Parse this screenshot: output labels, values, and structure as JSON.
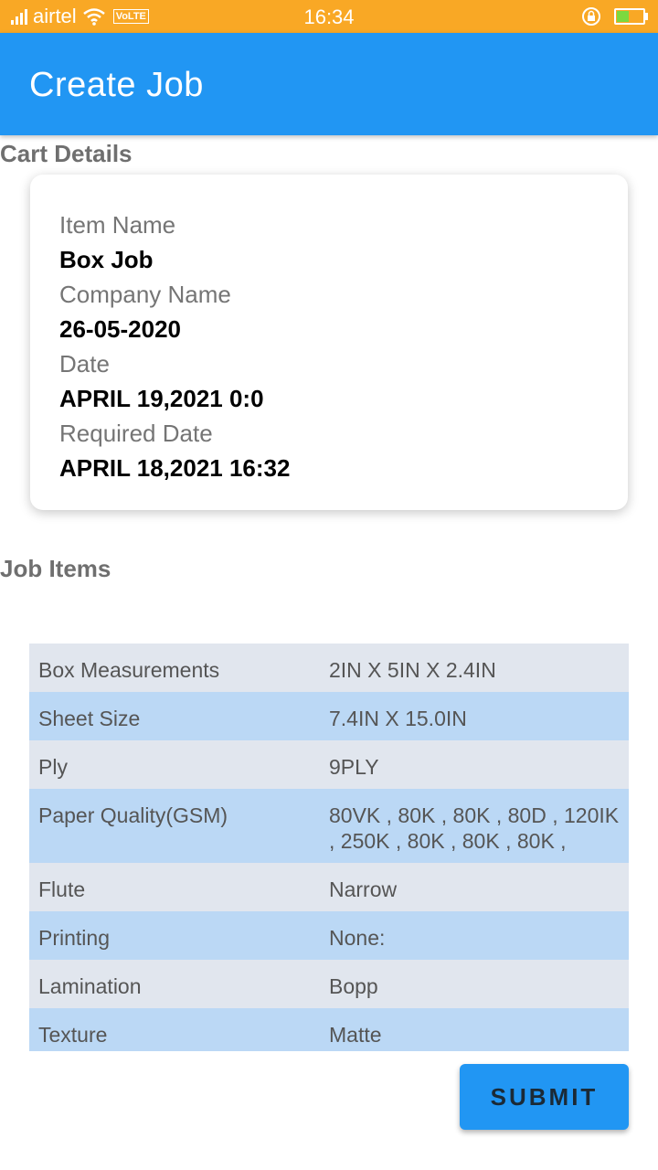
{
  "status_bar": {
    "carrier": "airtel",
    "volte": "VoLTE",
    "time": "16:34",
    "battery_level": 0.5,
    "icons": [
      "signal-icon",
      "wifi-icon",
      "rotation-lock-icon",
      "battery-charging-icon"
    ]
  },
  "app_bar": {
    "title": "Create Job"
  },
  "cart_section": {
    "title": "Cart Details"
  },
  "cart": [
    {
      "label": "Item Name",
      "value": "Box Job"
    },
    {
      "label": "Company Name",
      "value": "26-05-2020"
    },
    {
      "label": "Date",
      "value": "APRIL 19,2021 0:0"
    },
    {
      "label": "Required Date",
      "value": "APRIL 18,2021 16:32"
    }
  ],
  "job_section": {
    "title": "Job Items"
  },
  "job_items": [
    {
      "key": "Box Measurements",
      "value": "2IN X 5IN X 2.4IN"
    },
    {
      "key": "Sheet Size",
      "value": "7.4IN  X  15.0IN"
    },
    {
      "key": "Ply",
      "value": "9PLY"
    },
    {
      "key": "Paper Quality(GSM)",
      "value": "80VK , 80K , 80K , 80D , 120IK , 250K , 80K , 80K , 80K ,"
    },
    {
      "key": "Flute",
      "value": "Narrow"
    },
    {
      "key": "Printing",
      "value": "None:"
    },
    {
      "key": "Lamination",
      "value": "Bopp"
    },
    {
      "key": "Texture",
      "value": "Matte"
    }
  ],
  "colors": {
    "status_bar": "#F9A825",
    "app_bar": "#2196F3",
    "row_light": "#E1E6EE",
    "row_blue": "#BBD8F5"
  },
  "submit": {
    "label": "SUBMIT"
  }
}
